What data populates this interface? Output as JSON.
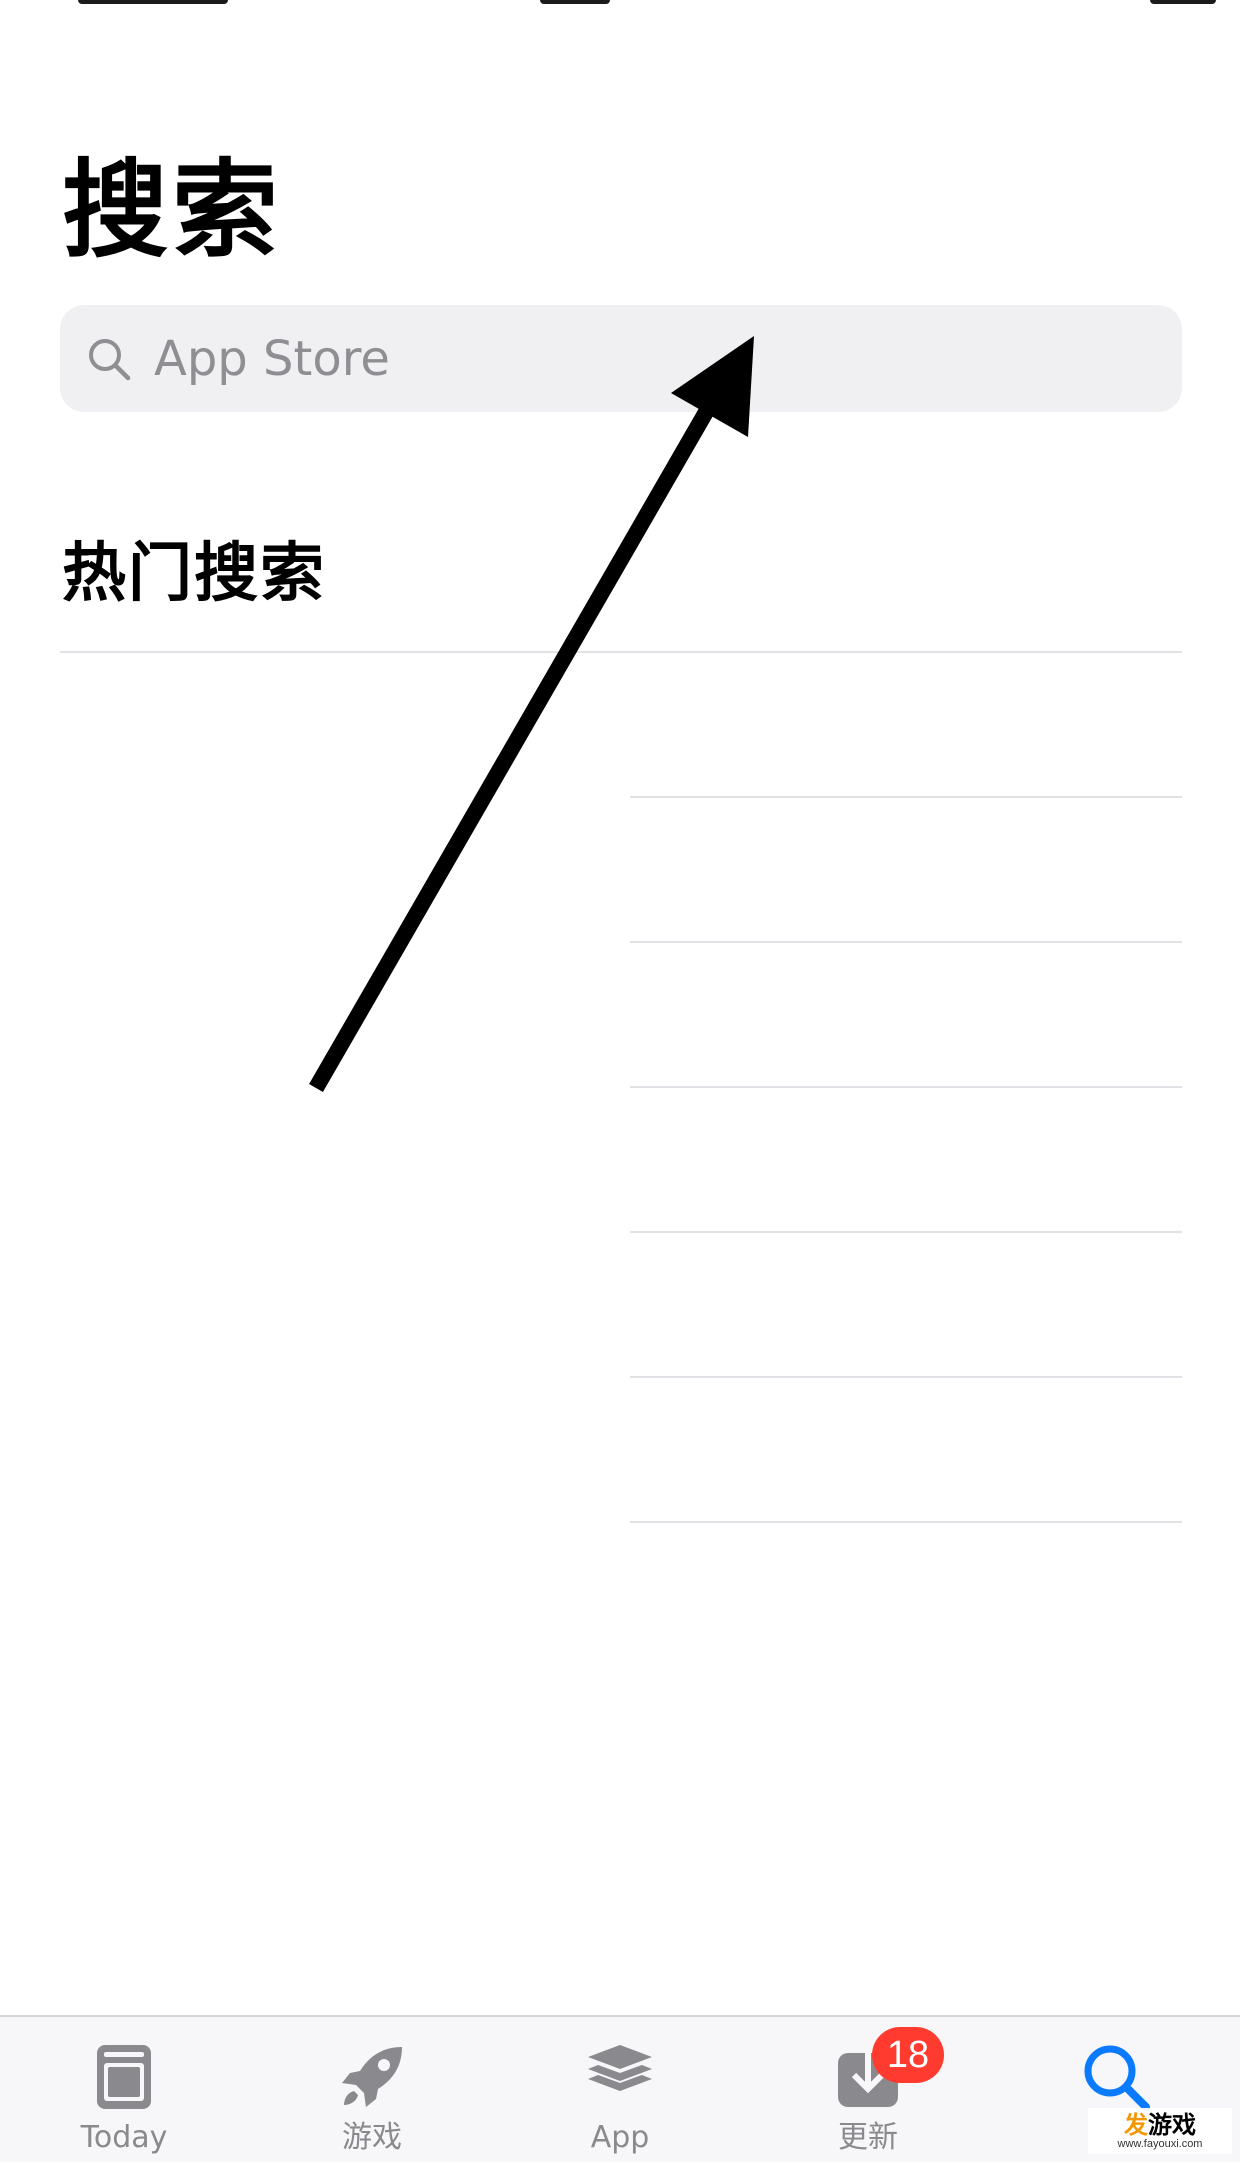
{
  "page": {
    "title": "搜索"
  },
  "search": {
    "placeholder": "App Store"
  },
  "trending": {
    "title": "热门搜索",
    "items": []
  },
  "tab_bar": {
    "tabs": [
      {
        "label": "Today",
        "icon": "today-icon"
      },
      {
        "label": "游戏",
        "icon": "rocket-icon"
      },
      {
        "label": "App",
        "icon": "layers-icon"
      },
      {
        "label": "更新",
        "icon": "download-icon",
        "badge": "18"
      },
      {
        "label": "",
        "icon": "search-icon",
        "active": true
      }
    ]
  },
  "watermark": {
    "accent": "发",
    "text": "游戏",
    "url": "www.fayouxi.com"
  },
  "colors": {
    "accent": "#0a7aff",
    "badge": "#ff3b30",
    "search_bg": "#f0f0f3",
    "inactive": "#8a8a8e"
  }
}
